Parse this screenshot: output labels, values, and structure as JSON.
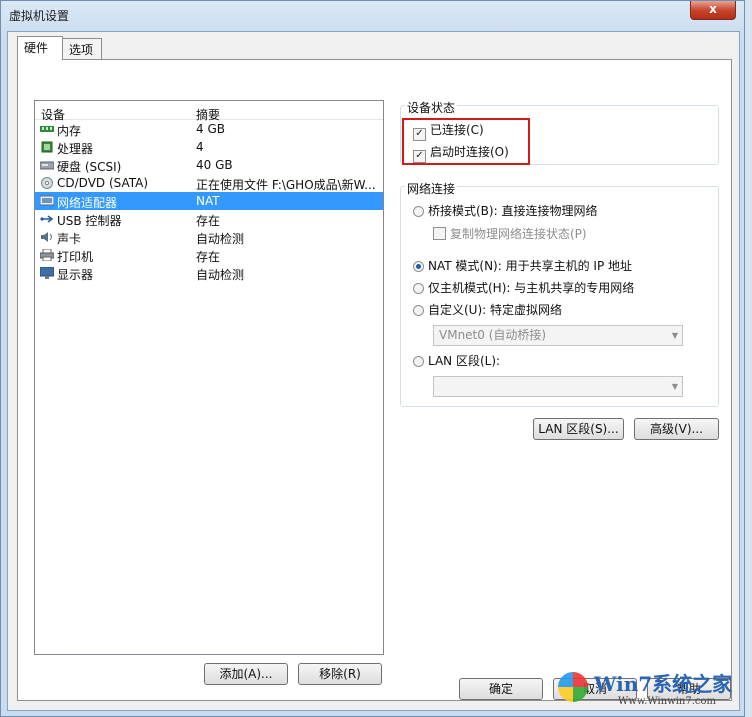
{
  "window": {
    "title": "虚拟机设置",
    "close_label": "x"
  },
  "tabs": [
    {
      "label": "硬件"
    },
    {
      "label": "选项"
    }
  ],
  "device_list": {
    "columns": {
      "device": "设备",
      "summary": "摘要"
    },
    "rows": [
      {
        "device": "内存",
        "summary": "4 GB",
        "icon": "memory-icon"
      },
      {
        "device": "处理器",
        "summary": "4",
        "icon": "processor-icon"
      },
      {
        "device": "硬盘 (SCSI)",
        "summary": "40 GB",
        "icon": "hard-disk-icon"
      },
      {
        "device": "CD/DVD (SATA)",
        "summary": "正在使用文件 F:\\GHO成品\\新W...",
        "icon": "cd-dvd-icon"
      },
      {
        "device": "网络适配器",
        "summary": "NAT",
        "icon": "network-adapter-icon",
        "selected": true
      },
      {
        "device": "USB 控制器",
        "summary": "存在",
        "icon": "usb-icon"
      },
      {
        "device": "声卡",
        "summary": "自动检测",
        "icon": "sound-card-icon"
      },
      {
        "device": "打印机",
        "summary": "存在",
        "icon": "printer-icon"
      },
      {
        "device": "显示器",
        "summary": "自动检测",
        "icon": "display-icon"
      }
    ],
    "add_label": "添加(A)...",
    "remove_label": "移除(R)"
  },
  "device_status": {
    "title": "设备状态",
    "connected_label": "已连接(C)",
    "connected_checked": true,
    "connect_at_power_on_label": "启动时连接(O)",
    "connect_at_power_on_checked": true
  },
  "network": {
    "title": "网络连接",
    "bridged_label": "桥接模式(B): 直接连接物理网络",
    "replicate_label": "复制物理网络连接状态(P)",
    "nat_label": "NAT 模式(N): 用于共享主机的 IP 地址",
    "hostonly_label": "仅主机模式(H): 与主机共享的专用网络",
    "custom_label": "自定义(U): 特定虚拟网络",
    "custom_value": "VMnet0 (自动桥接)",
    "lan_label": "LAN 区段(L):",
    "lan_value": "",
    "selected": "nat",
    "lan_segments_button": "LAN 区段(S)...",
    "advanced_button": "高级(V)..."
  },
  "footer": {
    "ok_label": "确定",
    "cancel_label": "取消",
    "help_label": "帮助"
  },
  "watermark": {
    "text": "Win7系统之家",
    "url": "Www.Winwin7.com"
  },
  "colors": {
    "selection": "#3399ff",
    "highlight_box": "#d21a1a"
  }
}
